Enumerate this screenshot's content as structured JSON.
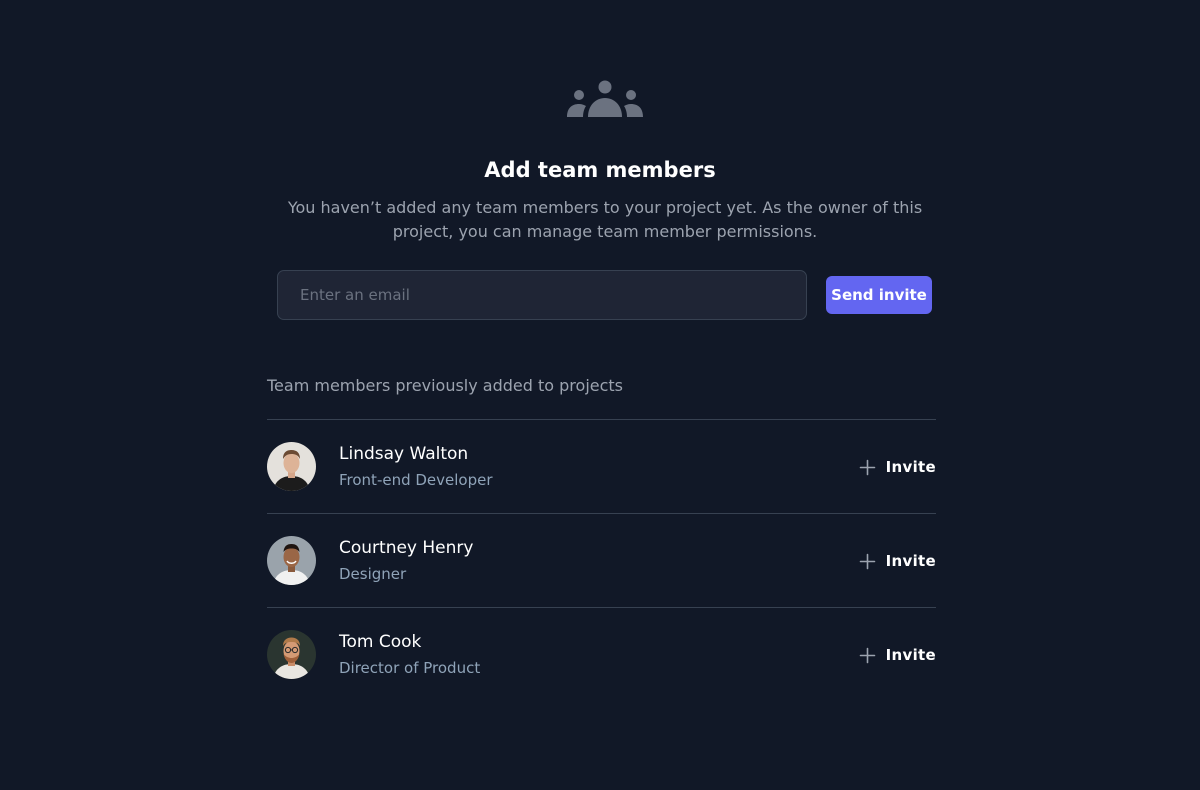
{
  "header": {
    "icon": "user-group-icon",
    "title": "Add team members",
    "subtitle": "You haven’t added any team members to your project yet. As the owner of this project, you can manage team member permissions."
  },
  "invite_form": {
    "email_placeholder": "Enter an email",
    "email_value": "",
    "submit_label": "Send invite"
  },
  "members_section": {
    "heading": "Team members previously added to projects",
    "members": [
      {
        "name": "Lindsay Walton",
        "role": "Front-end Developer",
        "action_label": "Invite",
        "action_icon": "plus-icon"
      },
      {
        "name": "Courtney Henry",
        "role": "Designer",
        "action_label": "Invite",
        "action_icon": "plus-icon"
      },
      {
        "name": "Tom Cook",
        "role": "Director of Product",
        "action_label": "Invite",
        "action_icon": "plus-icon"
      }
    ]
  },
  "colors": {
    "background": "#111827",
    "accent": "#6366f1",
    "muted_text": "#9ca3af",
    "role_text": "#8fa3b8",
    "divider": "#374151"
  }
}
